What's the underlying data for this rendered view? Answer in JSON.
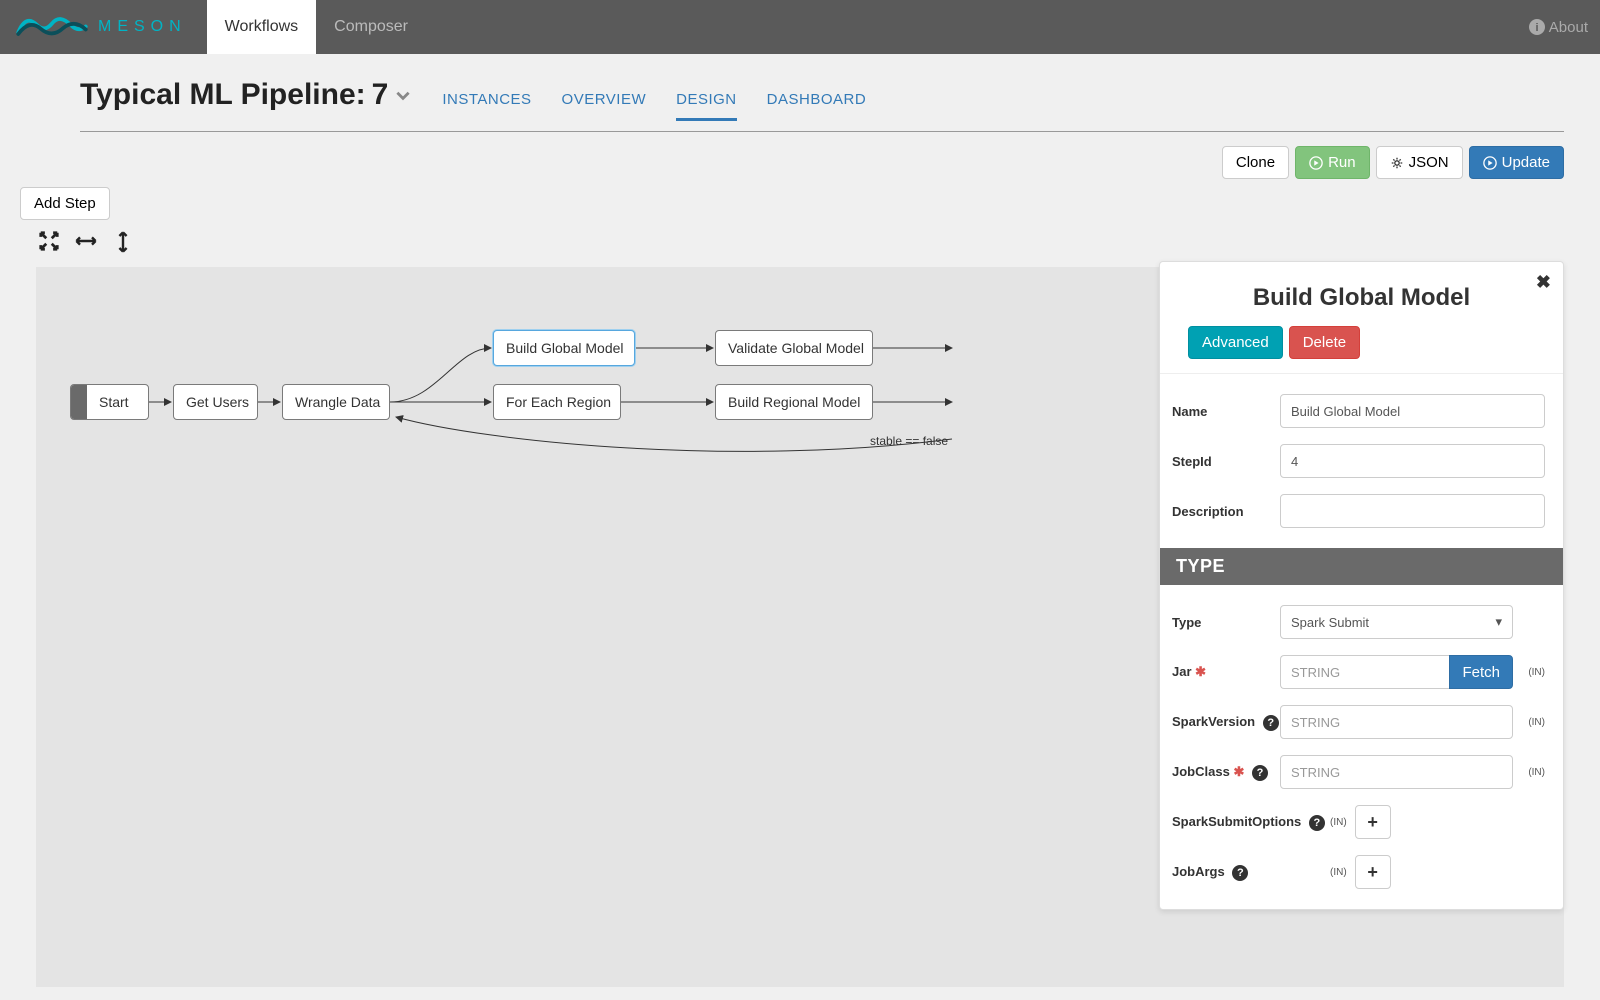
{
  "nav": {
    "brand": "meson",
    "tabs": {
      "workflows": "Workflows",
      "composer": "Composer"
    },
    "about": "About"
  },
  "header": {
    "title": "Typical ML Pipeline:",
    "version": "7",
    "subtabs": {
      "instances": "INSTANCES",
      "overview": "OVERVIEW",
      "design": "DESIGN",
      "dashboard": "DASHBOARD"
    }
  },
  "actions": {
    "clone": "Clone",
    "run": "Run",
    "json": "JSON",
    "update": "Update",
    "addstep": "Add Step"
  },
  "nodes": {
    "start": "Start",
    "getusers": "Get Users",
    "wrangle": "Wrangle Data",
    "buildglobal": "Build Global Model",
    "foreachregion": "For Each Region",
    "validateglobal": "Validate Global Model",
    "buildregional": "Build Regional Model"
  },
  "edgelabel": "stable == false",
  "panel": {
    "title": "Build Global Model",
    "buttons": {
      "advanced": "Advanced",
      "delete": "Delete"
    },
    "labels": {
      "name": "Name",
      "stepid": "StepId",
      "description": "Description",
      "typehead": "TYPE",
      "type": "Type",
      "jar": "Jar",
      "sparkversion": "SparkVersion",
      "jobclass": "JobClass",
      "sparksubmitoptions": "SparkSubmitOptions",
      "jobargs": "JobArgs",
      "fetch": "Fetch",
      "in": "(IN)"
    },
    "values": {
      "name": "Build Global Model",
      "stepid": "4",
      "type": "Spark Submit",
      "string_ph": "STRING"
    }
  }
}
